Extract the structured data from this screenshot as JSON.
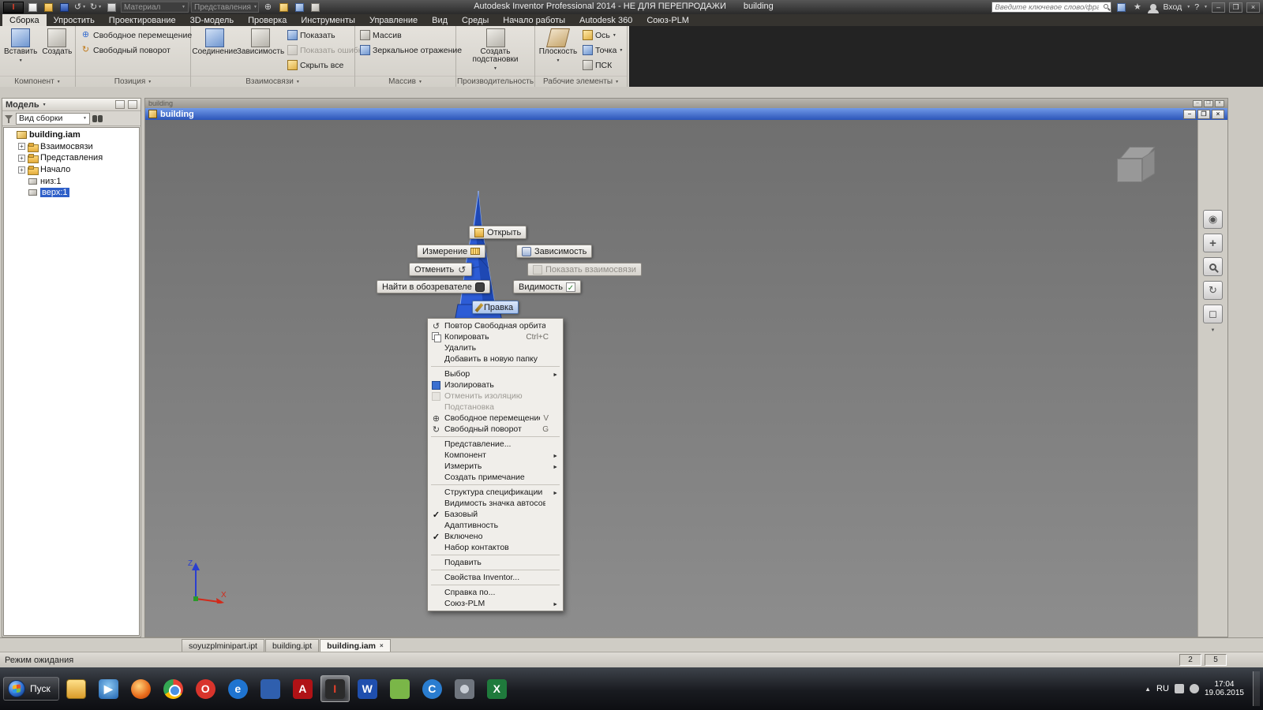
{
  "titlebar": {
    "title_main": "Autodesk Inventor Professional 2014 - НЕ ДЛЯ ПЕРЕПРОДАЖИ",
    "title_doc": "building",
    "material_combo": "Материал",
    "view_combo": "Представления",
    "search_placeholder": "Введите ключевое слово/фразу",
    "signin_label": "Вход",
    "help_label": "?"
  },
  "ribbon": {
    "tabs": [
      {
        "label": "Сборка",
        "active": true
      },
      {
        "label": "Упростить"
      },
      {
        "label": "Проектирование"
      },
      {
        "label": "3D-модель"
      },
      {
        "label": "Проверка"
      },
      {
        "label": "Инструменты"
      },
      {
        "label": "Управление"
      },
      {
        "label": "Вид"
      },
      {
        "label": "Среды"
      },
      {
        "label": "Начало работы"
      },
      {
        "label": "Autodesk 360"
      },
      {
        "label": "Союз-PLM"
      }
    ],
    "panels": {
      "component": {
        "label": "Компонент",
        "insert": "Вставить",
        "create": "Создать"
      },
      "position": {
        "label": "Позиция",
        "move": "Свободное перемещение",
        "rotate": "Свободный поворот"
      },
      "relationships": {
        "label": "Взаимосвязи",
        "joint": "Соединение",
        "constrain": "Зависимость",
        "show": "Показать",
        "show_errors": "Показать ошибки",
        "hide_all": "Скрыть все"
      },
      "pattern": {
        "label": "Массив",
        "pattern": "Массив",
        "mirror": "Зеркальное отражение"
      },
      "productivity": {
        "label": "Производительность",
        "substitutes": "Создать подстановки"
      },
      "work_features": {
        "label": "Рабочие элементы",
        "plane": "Плоскость",
        "axis": "Ось",
        "point": "Точка",
        "ucs": "ПСК"
      }
    }
  },
  "browser": {
    "header": "Модель",
    "view_combo": "Вид сборки",
    "tree": [
      {
        "label": "building.iam",
        "icon": "assembly",
        "bold": true,
        "indent": 0
      },
      {
        "label": "Взаимосвязи",
        "icon": "folder",
        "expand": "+",
        "indent": 1
      },
      {
        "label": "Представления",
        "icon": "folder",
        "expand": "+",
        "indent": 1
      },
      {
        "label": "Начало",
        "icon": "folder",
        "expand": "+",
        "indent": 1
      },
      {
        "label": "низ:1",
        "icon": "part",
        "indent": 1
      },
      {
        "label": "верх:1",
        "icon": "part",
        "selected": true,
        "indent": 1
      }
    ]
  },
  "doc_window": {
    "title": "building"
  },
  "marking_menu": {
    "open": "Открыть",
    "measure": "Измерение",
    "constrain": "Зависимость",
    "undo": "Отменить",
    "show_relationships": "Показать взаимосвязи",
    "find_in_browser": "Найти в обозревателе",
    "visibility": "Видимость",
    "edit": "Правка"
  },
  "context_menu": {
    "items": [
      {
        "label": "Повтор Свободная орбита",
        "icon": "orbit"
      },
      {
        "label": "Копировать",
        "icon": "copy",
        "shortcut": "Ctrl+C"
      },
      {
        "label": "Удалить"
      },
      {
        "label": "Добавить в новую папку"
      },
      {
        "separator": true
      },
      {
        "label": "Выбор",
        "submenu": true
      },
      {
        "label": "Изолировать",
        "icon": "isolate"
      },
      {
        "label": "Отменить изоляцию",
        "icon": "unisolate",
        "disabled": true
      },
      {
        "label": "Подстановка",
        "disabled": true
      },
      {
        "label": "Свободное перемещение",
        "icon": "move",
        "shortcut": "V"
      },
      {
        "label": "Свободный поворот",
        "icon": "rotate",
        "shortcut": "G"
      },
      {
        "separator": true
      },
      {
        "label": "Представление..."
      },
      {
        "label": "Компонент",
        "submenu": true
      },
      {
        "label": "Измерить",
        "submenu": true
      },
      {
        "label": "Создать примечание"
      },
      {
        "separator": true
      },
      {
        "label": "Структура спецификации",
        "submenu": true
      },
      {
        "label": "Видимость значка автосовмещения"
      },
      {
        "label": "Базовый",
        "checked": true
      },
      {
        "label": "Адаптивность"
      },
      {
        "label": "Включено",
        "checked": true
      },
      {
        "label": "Набор контактов"
      },
      {
        "separator": true
      },
      {
        "label": "Подавить"
      },
      {
        "separator": true
      },
      {
        "label": "Свойства Inventor..."
      },
      {
        "separator": true
      },
      {
        "label": "Справка по..."
      },
      {
        "label": "Союз-PLM",
        "submenu": true
      }
    ]
  },
  "doc_tabs": [
    {
      "label": "soyuzplminipart.ipt"
    },
    {
      "label": "building.ipt"
    },
    {
      "label": "building.iam",
      "active": true
    }
  ],
  "statusbar": {
    "message": "Режим ожидания",
    "counter1": "2",
    "counter2": "5"
  },
  "taskbar": {
    "start_label": "Пуск",
    "language": "RU",
    "time": "17:04",
    "date": "19.06.2015",
    "icons": [
      {
        "icon": "explorer",
        "glyph": ""
      },
      {
        "icon": "wmp",
        "glyph": "▶"
      },
      {
        "icon": "firefox",
        "glyph": "",
        "round": true
      },
      {
        "icon": "chrome",
        "glyph": "",
        "round": true
      },
      {
        "icon": "opera",
        "glyph": "O",
        "color": "#d8342c",
        "fg": "#ffffff",
        "round": true
      },
      {
        "icon": "ie",
        "glyph": "e",
        "color": "#1f74d0",
        "fg": "#ffffff",
        "round": true
      },
      {
        "icon": "app-blue",
        "glyph": "",
        "color": "#2f5fae"
      },
      {
        "icon": "acrobat",
        "glyph": "A",
        "color": "#b01216",
        "fg": "#ffffff"
      },
      {
        "icon": "inventor",
        "glyph": "I",
        "color": "#2b2b2b",
        "fg": "#e8402a",
        "active": true
      },
      {
        "icon": "word",
        "glyph": "W",
        "color": "#1f4fae",
        "fg": "#ffffff"
      },
      {
        "icon": "notes",
        "glyph": "",
        "color": "#7ab648"
      },
      {
        "icon": "c-app",
        "glyph": "C",
        "color": "#2a7dd0",
        "fg": "#ffffff",
        "round": true
      },
      {
        "icon": "gear",
        "glyph": ""
      },
      {
        "icon": "excel",
        "glyph": "X",
        "color": "#1f7a3c",
        "fg": "#ffffff"
      }
    ]
  }
}
